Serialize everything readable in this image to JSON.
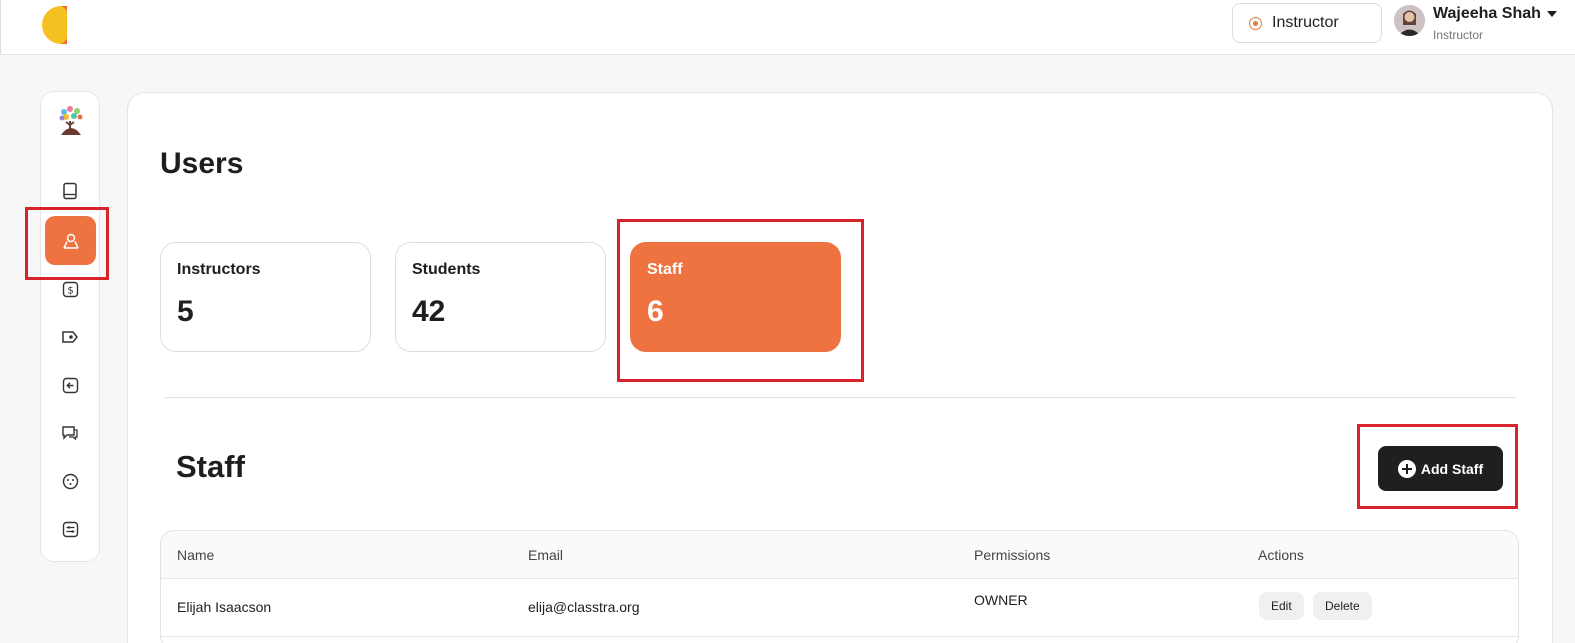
{
  "topbar": {
    "role_switch_label": "Instructor",
    "user": {
      "name": "Wajeeha Shah",
      "role": "Instructor"
    }
  },
  "sidenav": {
    "items": [
      {
        "icon": "book-icon"
      },
      {
        "icon": "users-icon",
        "active": true
      },
      {
        "icon": "dollar-icon"
      },
      {
        "icon": "tag-icon"
      },
      {
        "icon": "arrow-left-box-icon"
      },
      {
        "icon": "chat-icon"
      },
      {
        "icon": "smiley-icon"
      },
      {
        "icon": "settings-sliders-icon"
      }
    ]
  },
  "page": {
    "title": "Users",
    "stats": [
      {
        "label": "Instructors",
        "value": "5"
      },
      {
        "label": "Students",
        "value": "42"
      },
      {
        "label": "Staff",
        "value": "6",
        "active": true
      }
    ],
    "section_title": "Staff",
    "add_button_label": "Add Staff"
  },
  "table": {
    "headers": [
      "Name",
      "Email",
      "Permissions",
      "Actions"
    ],
    "rows": [
      {
        "name": "Elijah Isaacson",
        "email": "elija@classtra.org",
        "permissions": "OWNER",
        "actions": [
          "Edit",
          "Delete"
        ]
      }
    ]
  },
  "colors": {
    "accent": "#ef7340",
    "highlight": "#d6232c",
    "dark_button": "#1f1f1f"
  }
}
